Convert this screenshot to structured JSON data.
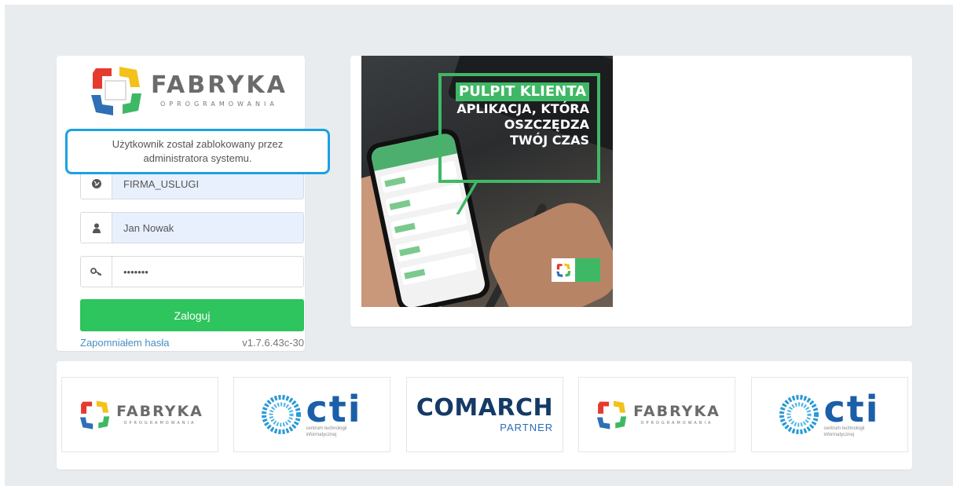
{
  "brand": {
    "name": "FABRYKA",
    "sub": "OPROGRAMOWANIA",
    "colors": {
      "red": "#e63a2e",
      "yellow": "#f2c21b",
      "green": "#3fb865",
      "blue": "#2f6fb5"
    }
  },
  "login": {
    "alert": "Użytkownik został zablokowany przez administratora systemu.",
    "company": {
      "icon": "globe-icon",
      "value": "FIRMA_USLUGI"
    },
    "user": {
      "icon": "user-icon",
      "value": "Jan Nowak"
    },
    "password": {
      "icon": "key-icon",
      "value": "•••••••"
    },
    "button_label": "Zaloguj",
    "forgot_label": "Zapomniałem hasła",
    "version": "v1.7.6.43c-30",
    "accent": "#2ec45e"
  },
  "promo": {
    "title": "PULPIT KLIENTA",
    "line1": "APLIKACJA, KTÓRA",
    "line2": "OSZCZĘDZA",
    "line3": "TWÓJ CZAS"
  },
  "partners": {
    "fabryka": {
      "name": "FABRYKA",
      "sub": "OPROGRAMOWANIA"
    },
    "cti": {
      "name": "cti",
      "sub": "centrum technologii\ninformatycznej"
    },
    "comarch": {
      "name": "COMARCH",
      "sub": "PARTNER"
    }
  }
}
